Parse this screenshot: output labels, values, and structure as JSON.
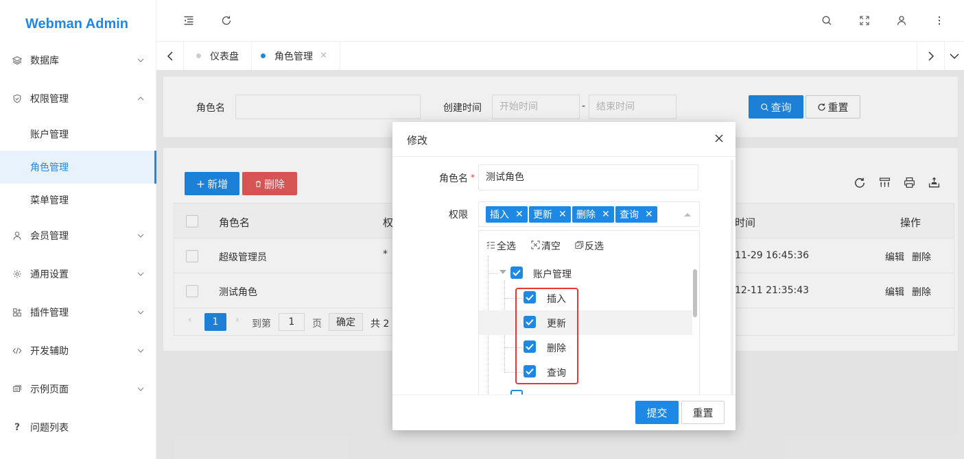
{
  "app": {
    "brand": "Webman Admin"
  },
  "sidebar": {
    "items": [
      {
        "label": "数据库",
        "icon": "layers-icon",
        "expanded": false
      },
      {
        "label": "权限管理",
        "icon": "shield-check-icon",
        "expanded": true
      },
      {
        "label": "账户管理",
        "sub": true
      },
      {
        "label": "角色管理",
        "sub": true,
        "active": true
      },
      {
        "label": "菜单管理",
        "sub": true
      },
      {
        "label": "会员管理",
        "icon": "user-icon",
        "expanded": false
      },
      {
        "label": "通用设置",
        "icon": "gear-icon",
        "expanded": false
      },
      {
        "label": "插件管理",
        "icon": "apps-icon",
        "expanded": false
      },
      {
        "label": "开发辅助",
        "icon": "code-icon",
        "expanded": false
      },
      {
        "label": "示例页面",
        "icon": "template-icon",
        "expanded": false
      },
      {
        "label": "问题列表",
        "icon": "question-icon"
      }
    ]
  },
  "topbar": {
    "icons": [
      "menu-fold-icon",
      "refresh-icon",
      "search-icon",
      "fullscreen-icon",
      "user-icon",
      "more-vertical-icon"
    ]
  },
  "tabs": [
    {
      "label": "仪表盘",
      "active": false
    },
    {
      "label": "角色管理",
      "active": true,
      "closable": true
    }
  ],
  "search": {
    "role_label": "角色名",
    "time_label": "创建时间",
    "start_placeholder": "开始时间",
    "dash": "-",
    "end_placeholder": "结束时间",
    "query_button": "查询",
    "reset_button": "重置"
  },
  "table": {
    "add_button": "新增",
    "delete_button": "删除",
    "columns": [
      "角色名",
      "权",
      "时间",
      "操作"
    ],
    "rows": [
      {
        "name": "超级管理员",
        "perm": "*",
        "time": "11-29 16:45:36",
        "edit": "编辑",
        "del": "删除"
      },
      {
        "name": "测试角色",
        "perm": "",
        "time": "12-11 21:35:43",
        "edit": "编辑",
        "del": "删除"
      }
    ],
    "pager": {
      "current": "1",
      "goto_label": "到第",
      "page_input": "1",
      "page_unit": "页",
      "confirm": "确定",
      "total": "共 2"
    }
  },
  "modal": {
    "title": "修改",
    "role_label": "角色名",
    "required_mark": "*",
    "role_value": "测试角色",
    "perm_label": "权限",
    "tags": [
      "插入",
      "更新",
      "删除",
      "查询"
    ],
    "tools": {
      "select_all": "全选",
      "clear": "清空",
      "invert": "反选"
    },
    "tree": {
      "parent": "账户管理",
      "children": [
        "插入",
        "更新",
        "删除",
        "查询"
      ]
    },
    "submit_button": "提交",
    "reset_button": "重置"
  },
  "colors": {
    "primary": "#1e88e5",
    "danger": "#e35b5b",
    "highlight_box": "#e53935"
  }
}
